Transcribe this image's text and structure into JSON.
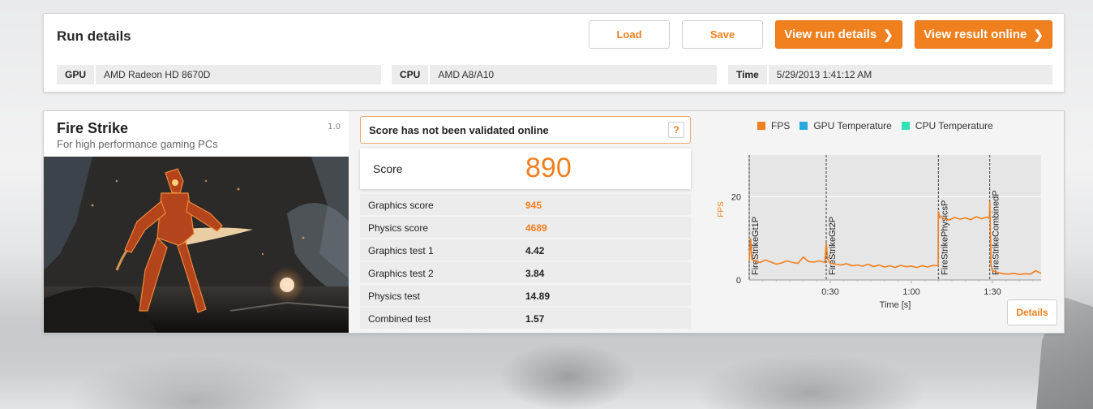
{
  "header": {
    "title": "Run details",
    "load_label": "Load",
    "save_label": "Save",
    "view_run_label": "View run details",
    "view_online_label": "View result online",
    "chevron": "❯"
  },
  "system": {
    "gpu_label": "GPU",
    "gpu_value": "AMD Radeon HD 8670D",
    "cpu_label": "CPU",
    "cpu_value": "AMD A8/A10",
    "time_label": "Time",
    "time_value": "5/29/2013 1:41:12 AM"
  },
  "benchmark": {
    "name": "Fire Strike",
    "subtitle": "For high performance gaming PCs",
    "version": "1.0"
  },
  "validation": {
    "message": "Score has not been validated online",
    "help_label": "?"
  },
  "score": {
    "label": "Score",
    "value": "890"
  },
  "results": [
    {
      "label": "Graphics score",
      "value": "945",
      "highlight": true
    },
    {
      "label": "Physics score",
      "value": "4689",
      "highlight": true
    },
    {
      "label": "Graphics test 1",
      "value": "4.42",
      "highlight": false
    },
    {
      "label": "Graphics test 2",
      "value": "3.84",
      "highlight": false
    },
    {
      "label": "Physics test",
      "value": "14.89",
      "highlight": false
    },
    {
      "label": "Combined test",
      "value": "1.57",
      "highlight": false
    }
  ],
  "legend": [
    {
      "name": "FPS",
      "color": "#f07f1e"
    },
    {
      "name": "GPU Temperature",
      "color": "#29a8e0"
    },
    {
      "name": "CPU Temperature",
      "color": "#2fe3b6"
    }
  ],
  "details_label": "Details",
  "colors": {
    "accent": "#f07f1e"
  },
  "chart_data": {
    "type": "line",
    "ylabel": "FPS",
    "xlabel": "Time [s]",
    "ylim": [
      0,
      30
    ],
    "xlim": [
      0,
      108
    ],
    "y_ticks": [
      {
        "v": 0,
        "label": "0"
      },
      {
        "v": 20,
        "label": "20"
      }
    ],
    "x_ticks": [
      {
        "v": 30,
        "label": "0:30"
      },
      {
        "v": 60,
        "label": "1:00"
      },
      {
        "v": 90,
        "label": "1:30"
      }
    ],
    "markers": [
      {
        "x": 0,
        "label": "FireStrikeGt1P"
      },
      {
        "x": 28.5,
        "label": "FireStrikeGt2P"
      },
      {
        "x": 70,
        "label": "FireStrikePhysicsP"
      },
      {
        "x": 89,
        "label": "FireStrikeCombinedP"
      }
    ],
    "series": [
      {
        "name": "FPS",
        "x": [
          0,
          0.5,
          1,
          2,
          4,
          6,
          8,
          10,
          12,
          14,
          16,
          18,
          20,
          22,
          24,
          26,
          28,
          28.5,
          29,
          30,
          32,
          34,
          36,
          38,
          40,
          42,
          44,
          46,
          48,
          50,
          52,
          54,
          56,
          58,
          60,
          62,
          64,
          66,
          68,
          69.9,
          70,
          70.5,
          72,
          74,
          76,
          78,
          80,
          82,
          84,
          86,
          88,
          88.9,
          89,
          89.5,
          90,
          92,
          94,
          96,
          98,
          100,
          102,
          104,
          106,
          108
        ],
        "y": [
          4.5,
          10,
          5,
          4.5,
          4.2,
          4.8,
          4.3,
          3.8,
          4.1,
          4.6,
          4.2,
          4.0,
          5.5,
          4.4,
          4.3,
          4.6,
          4.2,
          9,
          5,
          4.0,
          3.8,
          3.6,
          3.9,
          3.4,
          3.6,
          3.3,
          3.8,
          3.2,
          3.6,
          3.1,
          3.4,
          3.0,
          3.5,
          3.2,
          3.3,
          3.0,
          3.4,
          3.1,
          3.5,
          3.4,
          16.5,
          15,
          14.8,
          14.4,
          15.0,
          14.6,
          14.9,
          14.5,
          15.2,
          14.7,
          15.1,
          14.8,
          19,
          3.5,
          2.2,
          1.8,
          1.5,
          1.4,
          1.6,
          1.3,
          1.5,
          1.4,
          2.2,
          1.6
        ]
      }
    ],
    "grid": true
  }
}
